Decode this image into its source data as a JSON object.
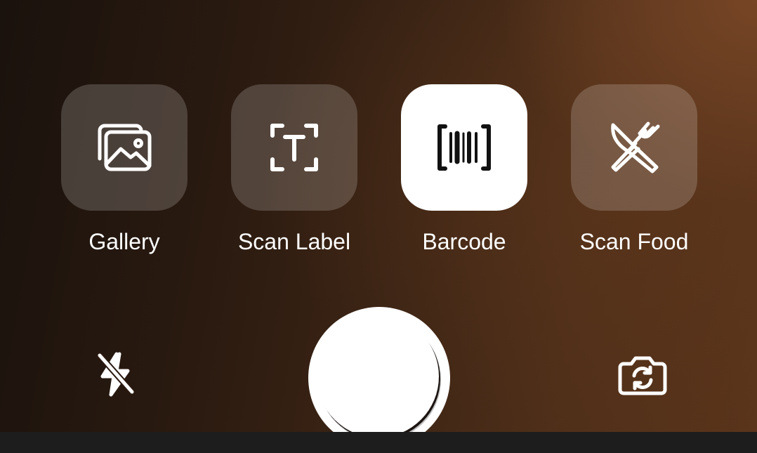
{
  "modes": [
    {
      "label": "Gallery",
      "icon": "gallery-icon",
      "active": false
    },
    {
      "label": "Scan Label",
      "icon": "text-scan-icon",
      "active": false
    },
    {
      "label": "Barcode",
      "icon": "barcode-icon",
      "active": true
    },
    {
      "label": "Scan Food",
      "icon": "food-scan-icon",
      "active": false
    }
  ],
  "controls": {
    "flash": {
      "icon": "flash-off-icon"
    },
    "shutter": {
      "icon": "shutter-button"
    },
    "flip_camera": {
      "icon": "camera-switch-icon"
    }
  },
  "colors": {
    "tile_inactive": "rgba(255,255,255,0.18)",
    "tile_active": "#ffffff",
    "text": "#ffffff",
    "background_dark": "#1a120d",
    "background_warm": "#5a341b"
  }
}
